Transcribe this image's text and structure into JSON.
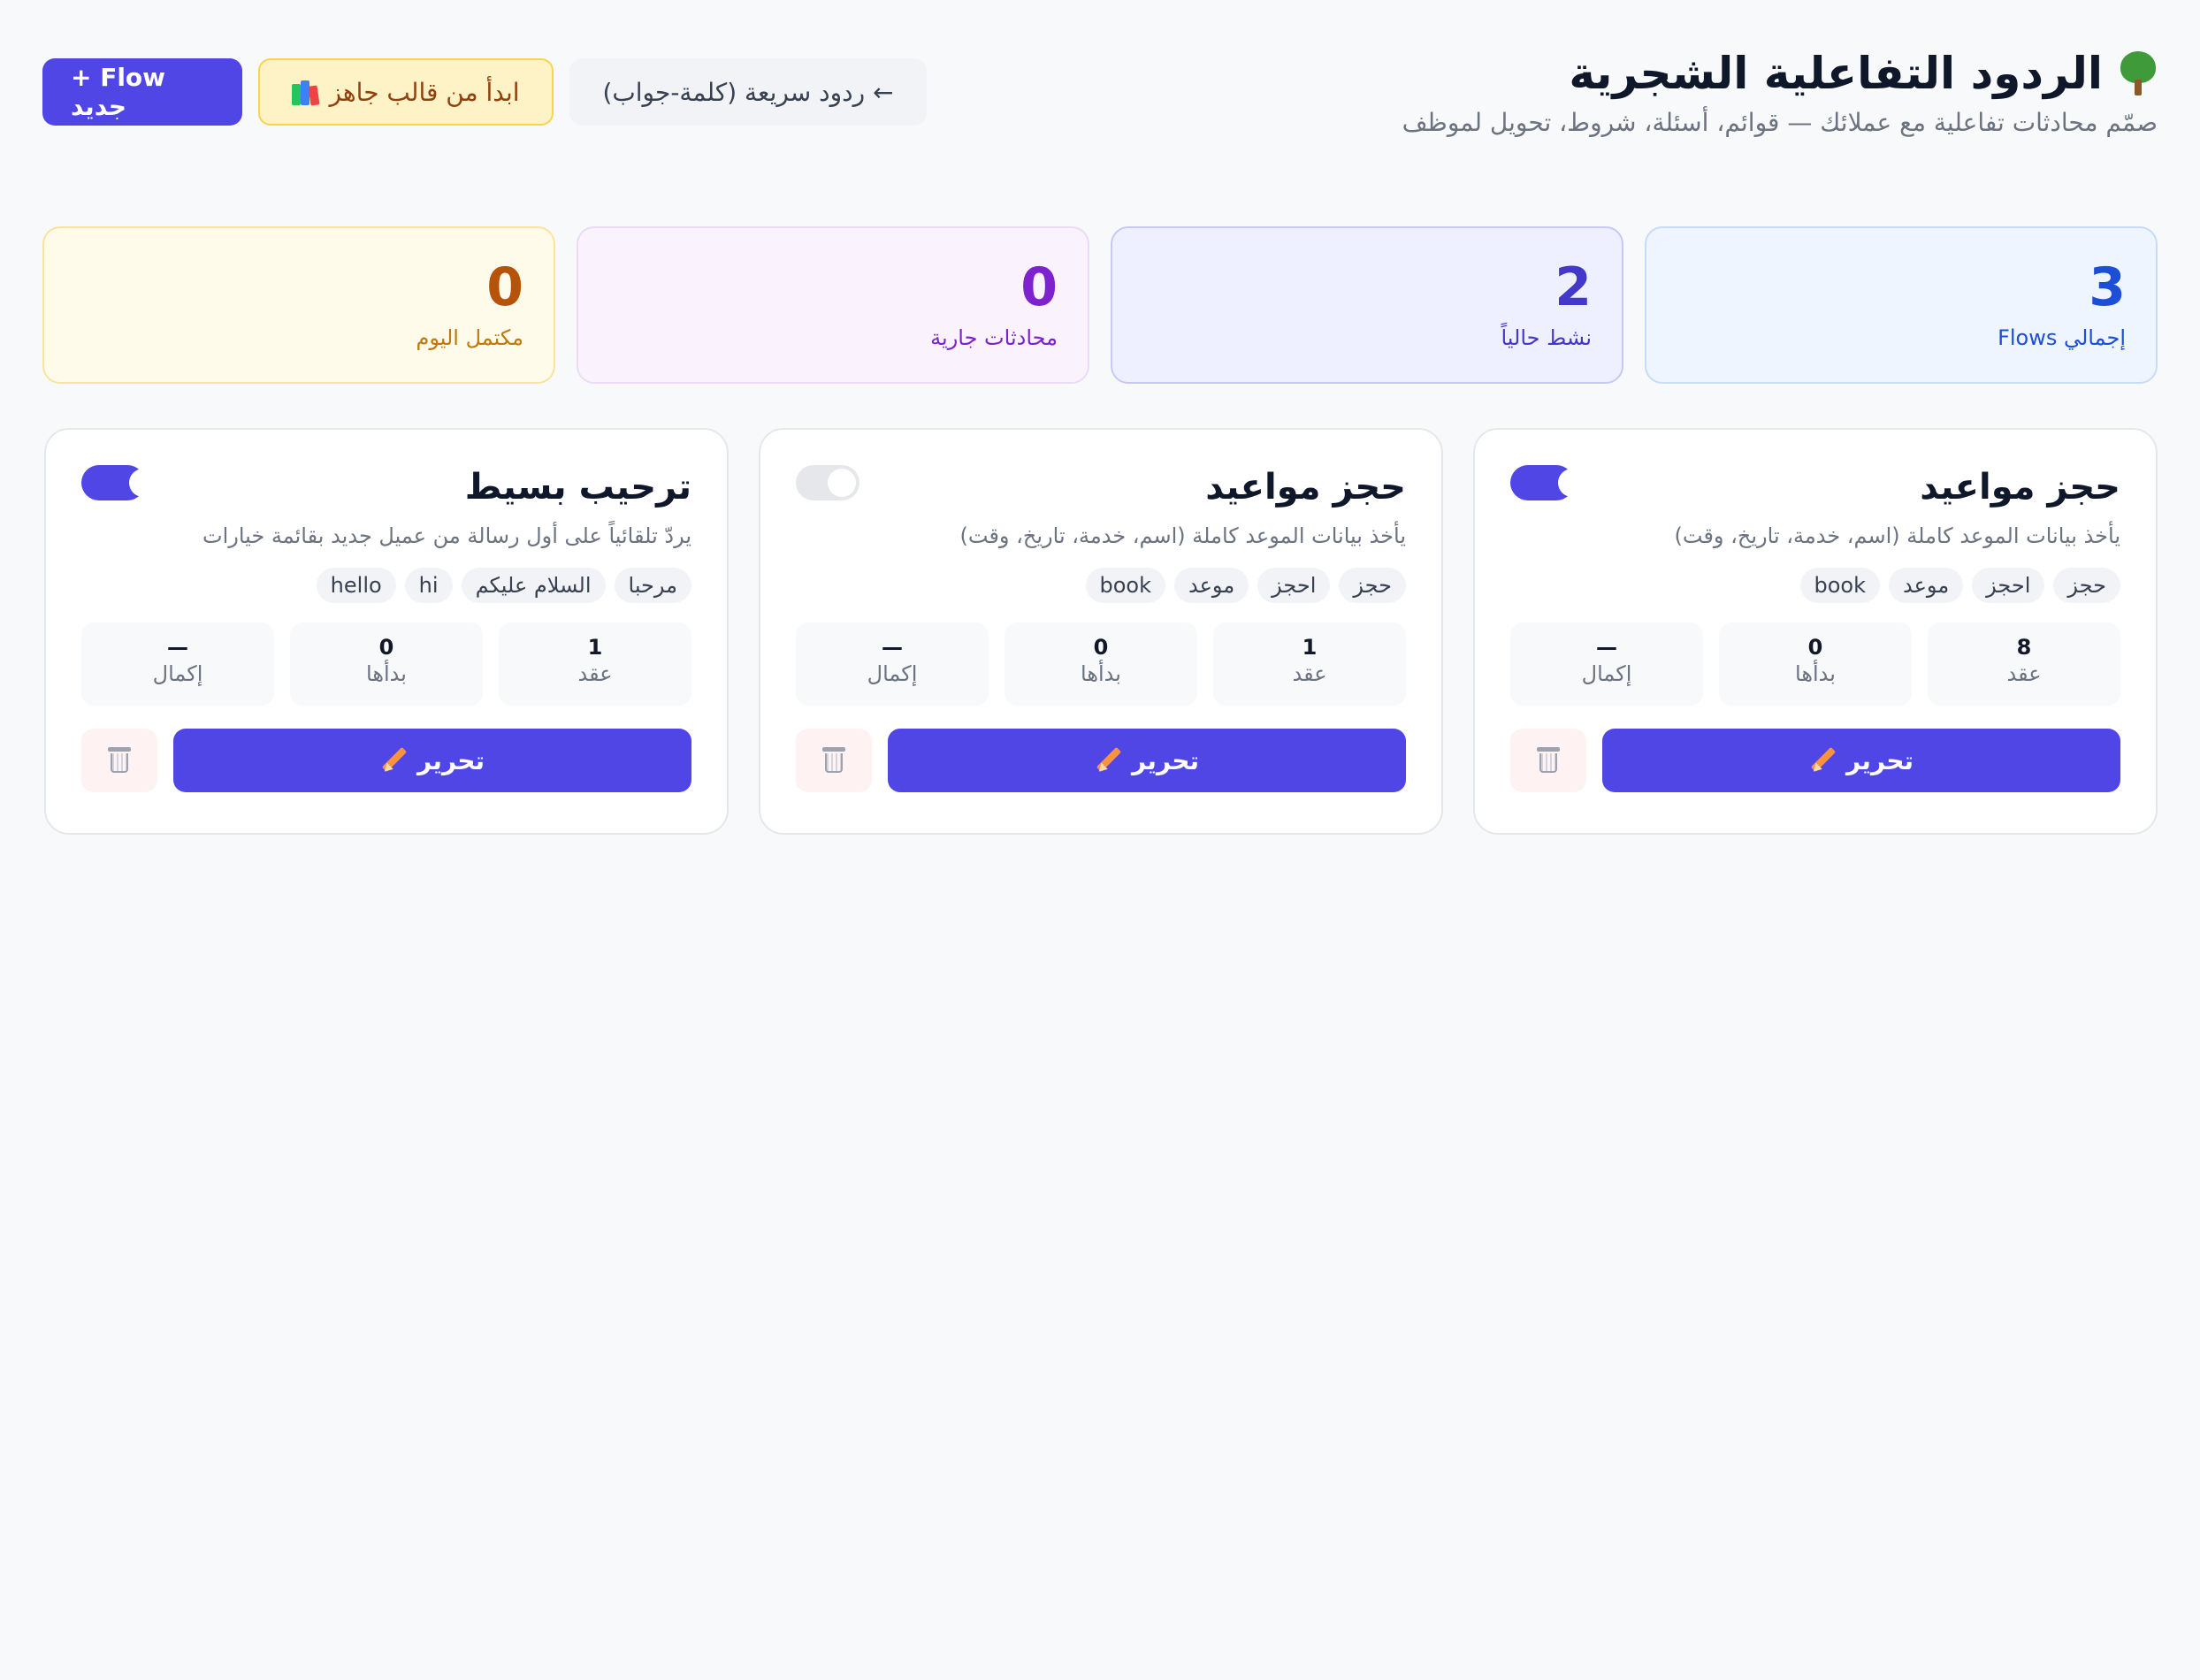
{
  "header": {
    "title": "الردود التفاعلية الشجرية",
    "title_icon": "tree-icon",
    "subtitle": "صمّم محادثات تفاعلية مع عملائك — قوائم، أسئلة، شروط، تحويل لموظف",
    "buttons": {
      "new_flow": "+ Flow جديد",
      "template": "ابدأ من قالب جاهز",
      "template_icon": "books-icon",
      "quick_replies": "← ردود سريعة (كلمة-جواب)"
    }
  },
  "stats": {
    "total": {
      "value": "3",
      "label": "إجمالي Flows"
    },
    "active": {
      "value": "2",
      "label": "نشط حالياً"
    },
    "running": {
      "value": "0",
      "label": "محادثات جارية"
    },
    "completed": {
      "value": "0",
      "label": "مكتمل اليوم"
    }
  },
  "flows": [
    {
      "title": "حجز مواعيد",
      "description": "يأخذ بيانات الموعد كاملة (اسم، خدمة، تاريخ، وقت)",
      "enabled": true,
      "tags": [
        "حجز",
        "احجز",
        "موعد",
        "book"
      ],
      "metrics": [
        {
          "value": "8",
          "label": "عقد"
        },
        {
          "value": "0",
          "label": "بدأها"
        },
        {
          "value": "—",
          "label": "إكمال"
        }
      ],
      "edit_label": "تحرير"
    },
    {
      "title": "حجز مواعيد",
      "description": "يأخذ بيانات الموعد كاملة (اسم، خدمة، تاريخ، وقت)",
      "enabled": false,
      "tags": [
        "حجز",
        "احجز",
        "موعد",
        "book"
      ],
      "metrics": [
        {
          "value": "1",
          "label": "عقد"
        },
        {
          "value": "0",
          "label": "بدأها"
        },
        {
          "value": "—",
          "label": "إكمال"
        }
      ],
      "edit_label": "تحرير"
    },
    {
      "title": "ترحيب بسيط",
      "description": "يردّ تلقائياً على أول رسالة من عميل جديد بقائمة خيارات",
      "enabled": true,
      "tags": [
        "مرحبا",
        "السلام عليكم",
        "hi",
        "hello"
      ],
      "metrics": [
        {
          "value": "1",
          "label": "عقد"
        },
        {
          "value": "0",
          "label": "بدأها"
        },
        {
          "value": "—",
          "label": "إكمال"
        }
      ],
      "edit_label": "تحرير"
    }
  ],
  "colors": {
    "primary": "#4f46e5",
    "total": "#1d4ed8",
    "active": "#4338ca",
    "running": "#7e22ce",
    "completed": "#b45309"
  }
}
